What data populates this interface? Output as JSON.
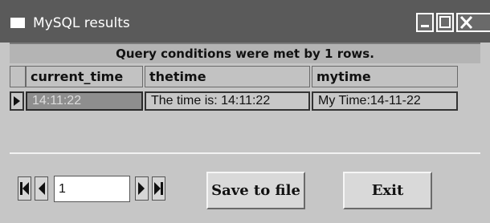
{
  "window": {
    "title": "MySQL results"
  },
  "grid": {
    "conditions": "Query conditions were met by 1 rows.",
    "columns": [
      "current_time",
      "thetime",
      "mytime"
    ],
    "rows": [
      [
        "14:11:22",
        "The time is: 14:11:22",
        "My Time:14-11-22"
      ]
    ]
  },
  "navigator": {
    "page_value": "1"
  },
  "buttons": {
    "save_label": "Save to file",
    "exit_label": "Exit"
  },
  "colors": {
    "titlebar": "#5a5a5a",
    "window_bg": "#c6c6c6",
    "selected_cell": "#8e8e8e"
  }
}
